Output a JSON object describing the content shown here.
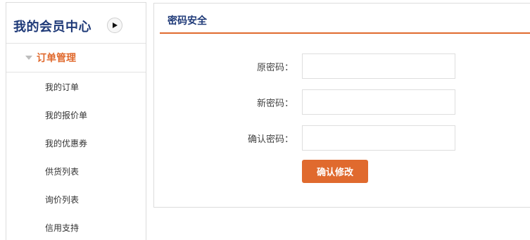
{
  "sidebar": {
    "title": "我的会员中心",
    "toggle_icon": "play-triangle-icon",
    "section": {
      "label": "订单管理",
      "expanded": true
    },
    "items": [
      {
        "label": "我的订单"
      },
      {
        "label": "我的报价单"
      },
      {
        "label": "我的优惠券"
      },
      {
        "label": "供货列表"
      },
      {
        "label": "询价列表"
      },
      {
        "label": "信用支持"
      }
    ]
  },
  "main": {
    "title": "密码安全",
    "fields": {
      "old_password": {
        "label": "原密码：",
        "value": ""
      },
      "new_password": {
        "label": "新密码：",
        "value": ""
      },
      "confirm_password": {
        "label": "确认密码：",
        "value": ""
      }
    },
    "submit_label": "确认修改"
  },
  "colors": {
    "accent": "#e06a2e",
    "title_blue": "#1f3a78",
    "border": "#dcdcdc"
  }
}
